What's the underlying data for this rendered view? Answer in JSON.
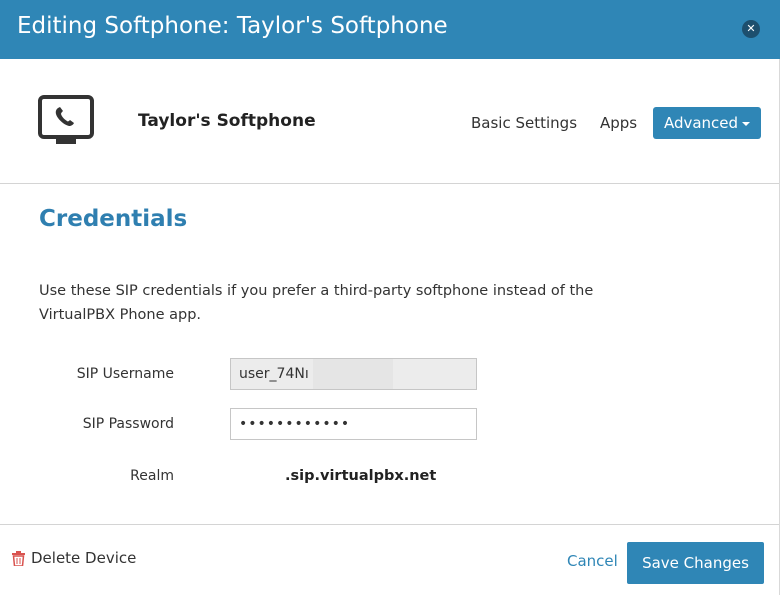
{
  "dialog": {
    "title": "Editing Softphone: Taylor's Softphone",
    "close_icon": "close-icon"
  },
  "device": {
    "icon": "softphone-monitor-icon",
    "name": "Taylor's Softphone"
  },
  "nav": {
    "basic_settings": "Basic Settings",
    "apps": "Apps",
    "advanced": "Advanced"
  },
  "credentials": {
    "title": "Credentials",
    "description": "Use these SIP credentials if you prefer a third-party softphone instead of the VirtualPBX Phone app.",
    "username_label": "SIP Username",
    "username_value": "user_74Nı",
    "password_label": "SIP Password",
    "password_value": "••••••••••••",
    "realm_label": "Realm",
    "realm_value": ".sip.virtualpbx.net"
  },
  "footer": {
    "delete_label": "Delete Device",
    "delete_icon": "trash-icon",
    "cancel_label": "Cancel",
    "save_label": "Save Changes"
  },
  "colors": {
    "brand": "#2f86b6",
    "title_text": "#2f7fb0",
    "delete_icon": "#d9534f"
  }
}
